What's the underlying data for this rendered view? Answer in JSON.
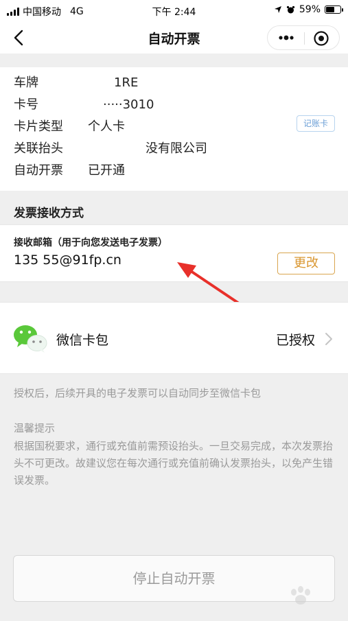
{
  "status_bar": {
    "carrier": "中国移动",
    "network": "4G",
    "time": "下午 2:44",
    "battery": "59%",
    "battery_level": 0.59
  },
  "nav": {
    "title": "自动开票",
    "back_icon": "chevron-left-icon",
    "more_icon": "more-dots-icon",
    "close_icon": "target-close-icon"
  },
  "card_info": {
    "rows": [
      {
        "label": "车牌",
        "value": "1RE"
      },
      {
        "label": "卡号",
        "value": "·····3010"
      },
      {
        "label": "卡片类型",
        "value": "个人卡"
      },
      {
        "label": "关联抬头",
        "value": "没有限公司"
      },
      {
        "label": "自动开票",
        "value": "已开通"
      }
    ],
    "badge": "记账卡"
  },
  "receive": {
    "section_title": "发票接收方式",
    "email_label": "接收邮箱（用于向您发送电子发票）",
    "email_value": "135        55@91fp.cn",
    "change_button": "更改"
  },
  "wallet": {
    "label": "微信卡包",
    "status": "已授权",
    "icon": "wechat-icon"
  },
  "notes": {
    "sync": "授权后，后续开具的电子发票可以自动同步至微信卡包",
    "tip_title": "温馨提示",
    "tip_body": "根据国税要求，通行或充值前需预设抬头。一旦交易完成，本次发票抬头不可更改。故建议您在每次通行或充值前确认发票抬头，以免产生错误发票。"
  },
  "footer": {
    "stop_button": "停止自动开票"
  },
  "colors": {
    "accent_orange": "#d9962f",
    "badge_blue": "#6a9ed6",
    "arrow_red": "#e8302a",
    "wechat_green": "#5ac83a"
  }
}
